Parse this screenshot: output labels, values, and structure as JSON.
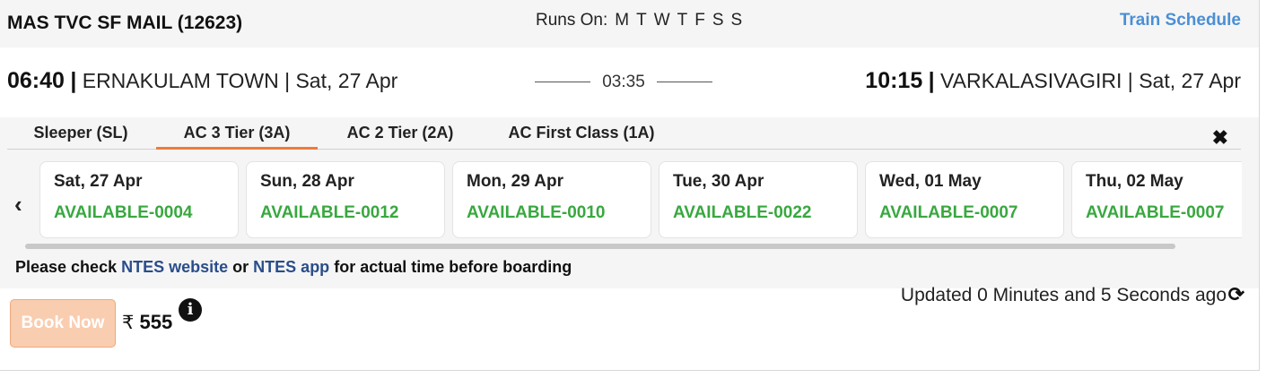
{
  "train": {
    "name": "MAS TVC SF MAIL (12623)"
  },
  "runs_on": {
    "label": "Runs On:",
    "days": [
      "M",
      "T",
      "W",
      "T",
      "F",
      "S",
      "S"
    ]
  },
  "schedule_link": "Train Schedule",
  "departure": {
    "time": "06:40",
    "station": "ERNAKULAM TOWN",
    "date": "Sat, 27 Apr"
  },
  "duration": "03:35",
  "arrival": {
    "time": "10:15",
    "station": "VARKALASIVAGIRI",
    "date": "Sat, 27 Apr"
  },
  "tabs": [
    {
      "label": "Sleeper (SL)",
      "active": false
    },
    {
      "label": "AC 3 Tier (3A)",
      "active": true
    },
    {
      "label": "AC 2 Tier (2A)",
      "active": false
    },
    {
      "label": "AC First Class (1A)",
      "active": false
    }
  ],
  "icons": {
    "close": "close-icon",
    "prev": "chevron-left-icon",
    "refresh": "refresh-icon",
    "info": "info-icon"
  },
  "availability": [
    {
      "date": "Sat, 27 Apr",
      "status": "AVAILABLE-0004"
    },
    {
      "date": "Sun, 28 Apr",
      "status": "AVAILABLE-0012"
    },
    {
      "date": "Mon, 29 Apr",
      "status": "AVAILABLE-0010"
    },
    {
      "date": "Tue, 30 Apr",
      "status": "AVAILABLE-0022"
    },
    {
      "date": "Wed, 01 May",
      "status": "AVAILABLE-0007"
    },
    {
      "date": "Thu, 02 May",
      "status": "AVAILABLE-0007"
    }
  ],
  "notice": {
    "prefix": "Please check",
    "link1": "NTES website",
    "middle": "or",
    "link2": "NTES app",
    "suffix": "for actual time before boarding"
  },
  "updated": "Updated 0 Minutes and 5 Seconds ago",
  "book_button": "Book Now",
  "fare": {
    "currency": "₹",
    "amount": "555"
  },
  "colors": {
    "available": "#38a83f",
    "link": "#4a8fd6",
    "active_tab": "#f07a3b",
    "book_bg": "#f9cdb0"
  }
}
